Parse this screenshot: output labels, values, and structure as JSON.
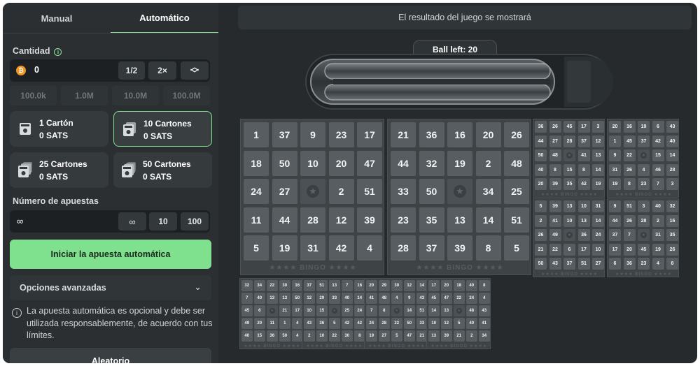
{
  "tabs": {
    "manual": "Manual",
    "auto": "Automático"
  },
  "amount": {
    "label": "Cantidad",
    "value": "0",
    "coin": "₿",
    "half": "1/2",
    "double": "2×",
    "up": "⌃",
    "down": "⌄"
  },
  "quick_amounts": [
    "100.0k",
    "1.0M",
    "10.0M",
    "100.0M"
  ],
  "cards_options": [
    {
      "title": "1 Cartón",
      "price": "0 SATS",
      "selected": false
    },
    {
      "title": "10 Cartones",
      "price": "0 SATS",
      "selected": true
    },
    {
      "title": "25 Cartones",
      "price": "0 SATS",
      "selected": false
    },
    {
      "title": "50 Cartones",
      "price": "0 SATS",
      "selected": false
    }
  ],
  "bets": {
    "label": "Número de apuestas",
    "value": "∞",
    "inf_btn": "∞",
    "ten": "10",
    "hundred": "100"
  },
  "start_button": "Iniciar la apuesta automática",
  "advanced": {
    "label": "Opciones avanzadas"
  },
  "note": "La apuesta automática es opcional y debe ser utilizada responsablemente, de acuerdo con tus límites.",
  "random_button": "Aleatorio",
  "result_text": "El resultado del juego se mostrará",
  "ball_left": "Ball left: 20",
  "card_footer": "★★★★ BINGO ★★★★",
  "colors": {
    "accent": "#7fe08e",
    "bg": "#262a2c",
    "panel": "#2b2f31",
    "coin": "#f0961f"
  },
  "bingo_cards_large": [
    [
      [
        1,
        37,
        9,
        23,
        17
      ],
      [
        18,
        50,
        10,
        20,
        47
      ],
      [
        24,
        27,
        null,
        2,
        51
      ],
      [
        11,
        44,
        28,
        12,
        39
      ],
      [
        5,
        19,
        31,
        42,
        4
      ]
    ],
    [
      [
        21,
        36,
        16,
        20,
        26
      ],
      [
        44,
        32,
        19,
        2,
        48
      ],
      [
        33,
        50,
        null,
        34,
        25
      ],
      [
        23,
        35,
        13,
        14,
        51
      ],
      [
        28,
        37,
        39,
        8,
        5
      ]
    ]
  ],
  "bingo_cards_small_top": [
    [
      [
        36,
        26,
        45,
        17,
        3
      ],
      [
        44,
        27,
        28,
        37,
        12
      ],
      [
        50,
        48,
        null,
        41,
        13
      ],
      [
        40,
        8,
        15,
        8,
        14
      ],
      [
        20,
        39,
        35,
        42,
        19
      ]
    ],
    [
      [
        20,
        16,
        19,
        6,
        43
      ],
      [
        1,
        45,
        37,
        42,
        40
      ],
      [
        9,
        22,
        null,
        15,
        14
      ],
      [
        31,
        26,
        4,
        46,
        28
      ],
      [
        19,
        8,
        23,
        7,
        3
      ]
    ]
  ],
  "bingo_cards_small_mid": [
    [
      [
        5,
        39,
        13,
        10,
        31
      ],
      [
        2,
        41,
        10,
        13,
        14
      ],
      [
        26,
        49,
        null,
        36,
        24
      ],
      [
        21,
        22,
        6,
        17,
        10
      ],
      [
        50,
        43,
        37,
        51,
        27
      ]
    ],
    [
      [
        9,
        51,
        3,
        40,
        32
      ],
      [
        44,
        26,
        28,
        2,
        16
      ],
      [
        37,
        7,
        null,
        31,
        35
      ],
      [
        17,
        20,
        45,
        19,
        26
      ],
      [
        6,
        36,
        23,
        4,
        8
      ]
    ]
  ],
  "bingo_cards_small_bottom": [
    [
      [
        32,
        34,
        22,
        30,
        16
      ],
      [
        7,
        40,
        13,
        13,
        50
      ],
      [
        45,
        6,
        null,
        21,
        17
      ],
      [
        49,
        20,
        11,
        1,
        4
      ],
      [
        40,
        15,
        36,
        50,
        4
      ]
    ],
    [
      [
        37,
        51,
        13,
        7,
        16
      ],
      [
        12,
        29,
        33,
        40,
        14
      ],
      [
        10,
        15,
        null,
        25,
        24
      ],
      [
        43,
        36,
        5,
        42,
        42
      ],
      [
        2,
        10,
        22,
        30,
        8
      ]
    ],
    [
      [
        20,
        29,
        30,
        12,
        14
      ],
      [
        41,
        48,
        4,
        9,
        43
      ],
      [
        7,
        8,
        null,
        14,
        51
      ],
      [
        24,
        28,
        22,
        50,
        33
      ],
      [
        19,
        27,
        5,
        47,
        21
      ]
    ],
    [
      [
        17,
        20,
        18,
        40,
        8
      ],
      [
        45,
        47,
        22,
        24,
        4
      ],
      [
        14,
        13,
        null,
        48,
        43
      ],
      [
        10,
        12,
        5,
        40,
        41
      ],
      [
        13,
        39,
        21,
        2,
        34
      ]
    ]
  ]
}
